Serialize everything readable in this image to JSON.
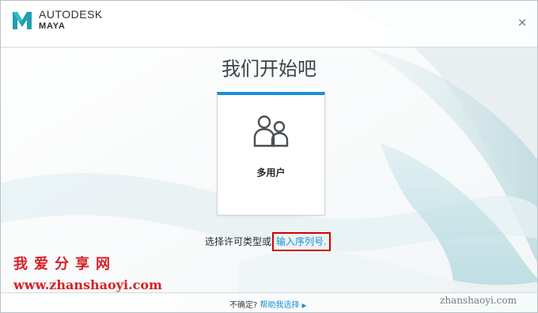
{
  "header": {
    "brand_line1": "AUTODESK",
    "brand_line2": "MAYA",
    "close_glyph": "×"
  },
  "main": {
    "title": "我们开始吧",
    "card": {
      "label": "多用户",
      "icon": "multi-user-icon"
    },
    "license_prompt": "选择许可类型或",
    "serial_link": "输入序列号."
  },
  "watermark": {
    "title": "我爱分享网",
    "url": "www.zhanshaoyi.com",
    "url_right": "zhanshaoyi.com"
  },
  "footer": {
    "question": "不确定?",
    "help_link": "帮助我选择",
    "arrow_glyph": "▶"
  },
  "colors": {
    "accent": "#1e8fd2",
    "highlight": "#d40000",
    "watermark": "#d81f26"
  }
}
